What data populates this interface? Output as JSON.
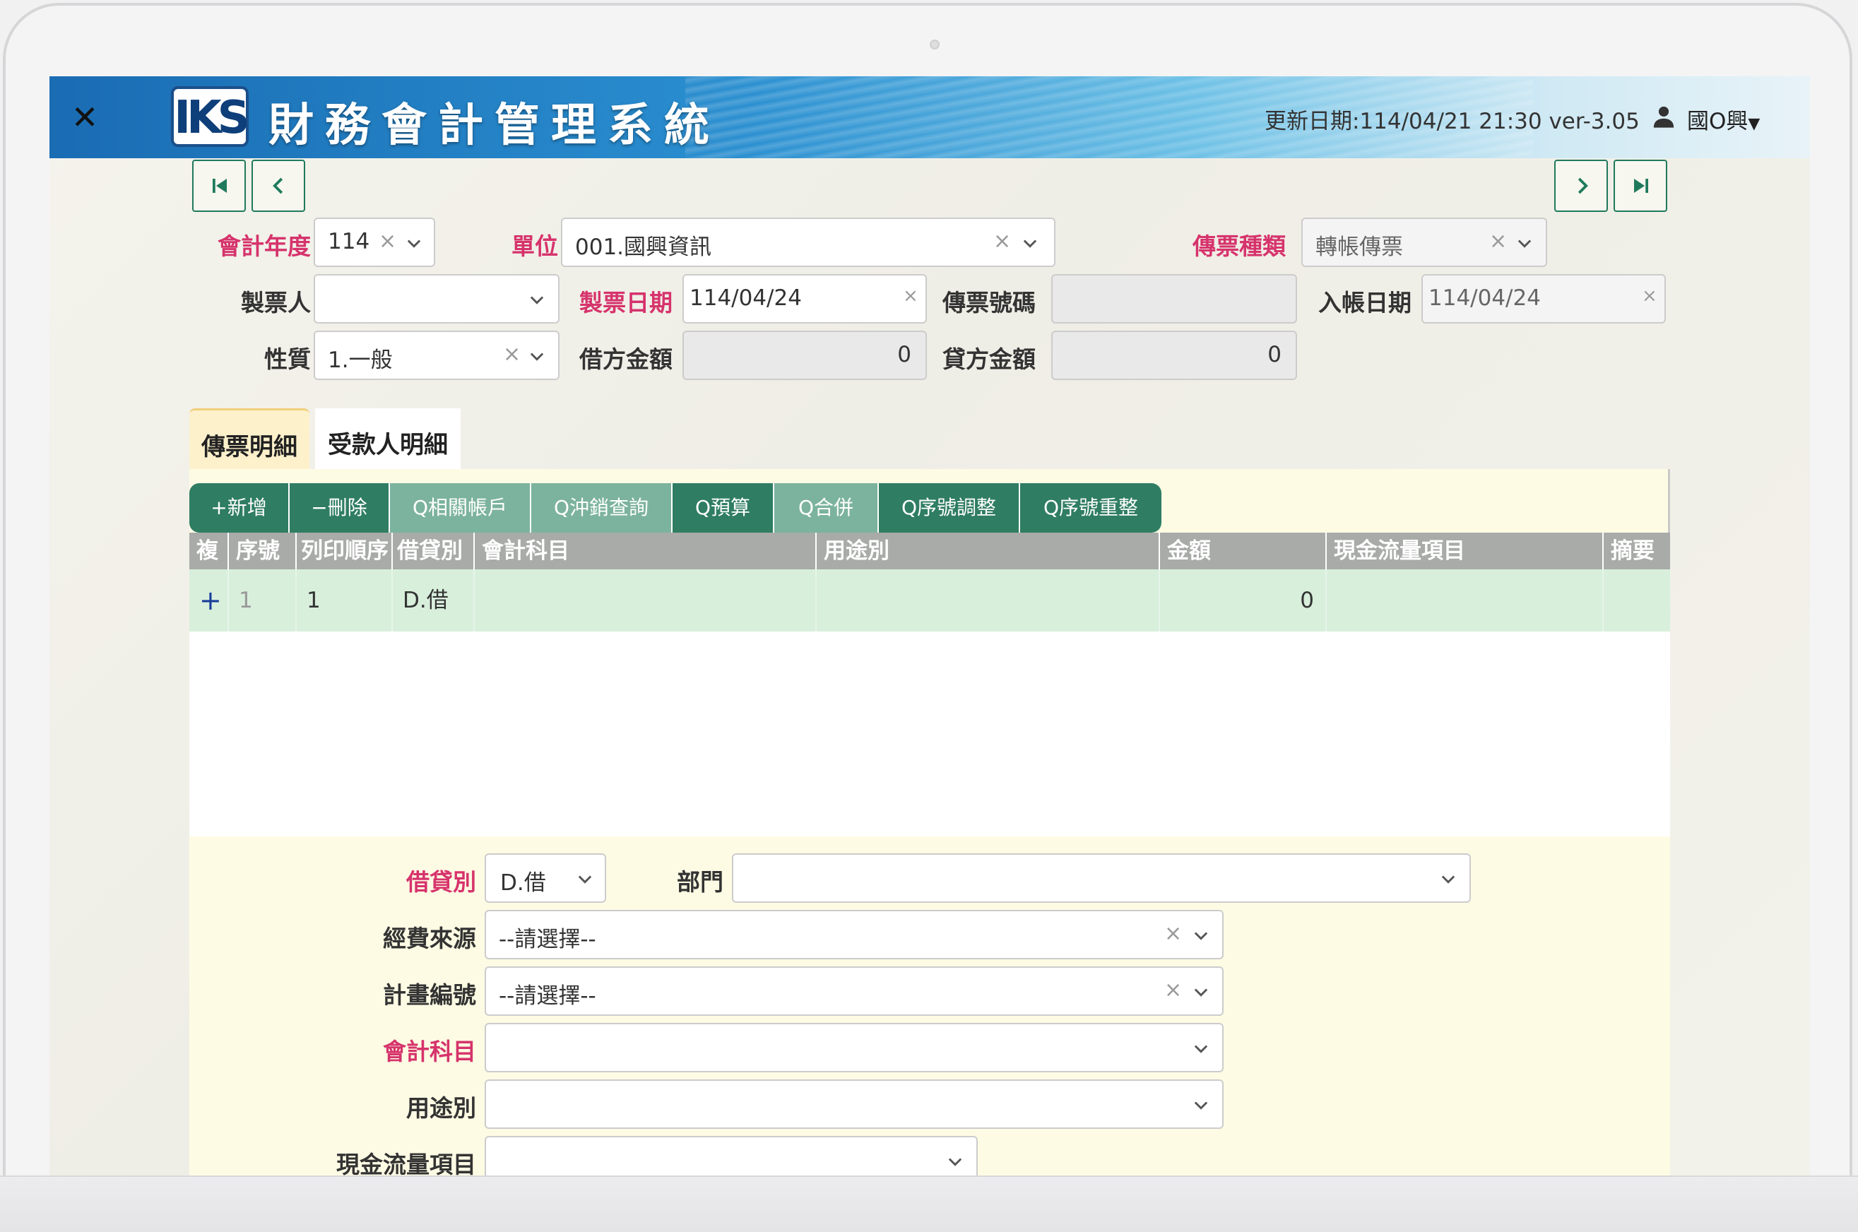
{
  "header": {
    "close_icon": "close-icon",
    "logo_text": "IKS",
    "title": "財務會計管理系統",
    "update_info": "更新日期:114/04/21 21:30 ver-3.05",
    "user_name": "國O興"
  },
  "nav": {
    "first": "first-page-icon",
    "prev": "prev-icon",
    "next": "next-icon",
    "last": "last-page-icon"
  },
  "form": {
    "fiscal_year": {
      "label": "會計年度",
      "value": "114"
    },
    "unit": {
      "label": "單位",
      "value": "001.國興資訊"
    },
    "voucher_type": {
      "label": "傳票種類",
      "value": "轉帳傳票"
    },
    "preparer": {
      "label": "製票人",
      "value": ""
    },
    "voucher_date": {
      "label": "製票日期",
      "value": "114/04/24"
    },
    "voucher_no": {
      "label": "傳票號碼",
      "value": ""
    },
    "posting_date": {
      "label": "入帳日期",
      "value": "114/04/24"
    },
    "nature": {
      "label": "性質",
      "value": "1.一般"
    },
    "debit_amount": {
      "label": "借方金額",
      "value": "0"
    },
    "credit_amount": {
      "label": "貸方金額",
      "value": "0"
    }
  },
  "tabs": [
    {
      "label": "傳票明細"
    },
    {
      "label": "受款人明細"
    }
  ],
  "toolbar": [
    {
      "label": "+新增"
    },
    {
      "label": "−刪除"
    },
    {
      "label": "Q相關帳戶"
    },
    {
      "label": "Q沖銷查詢"
    },
    {
      "label": "Q預算"
    },
    {
      "label": "Q合併"
    },
    {
      "label": "Q序號調整"
    },
    {
      "label": "Q序號重整"
    }
  ],
  "grid": {
    "columns": [
      "複",
      "序號",
      "列印順序",
      "借貸別",
      "會計科目",
      "用途別",
      "金額",
      "現金流量項目",
      "摘要"
    ],
    "rows": [
      {
        "copy": "+",
        "seq": "1",
        "print_order": "1",
        "dc": "D.借",
        "account": "",
        "purpose": "",
        "amount": "0",
        "cashflow": "",
        "summary": ""
      }
    ]
  },
  "detail": {
    "dc": {
      "label": "借貸別",
      "value": "D.借"
    },
    "dept": {
      "label": "部門",
      "value": ""
    },
    "fund_source": {
      "label": "經費來源",
      "value": "--請選擇--"
    },
    "project_no": {
      "label": "計畫編號",
      "value": "--請選擇--"
    },
    "account": {
      "label": "會計科目",
      "value": ""
    },
    "purpose": {
      "label": "用途別",
      "value": ""
    },
    "cashflow": {
      "label": "現金流量項目",
      "value": ""
    }
  },
  "colors": {
    "required_label": "#d6336c",
    "toolbar_dark": "#2f7d63",
    "toolbar_light": "#7cb39e",
    "row_highlight": "#d8efdc",
    "panel_bg": "#fdfbe4"
  }
}
